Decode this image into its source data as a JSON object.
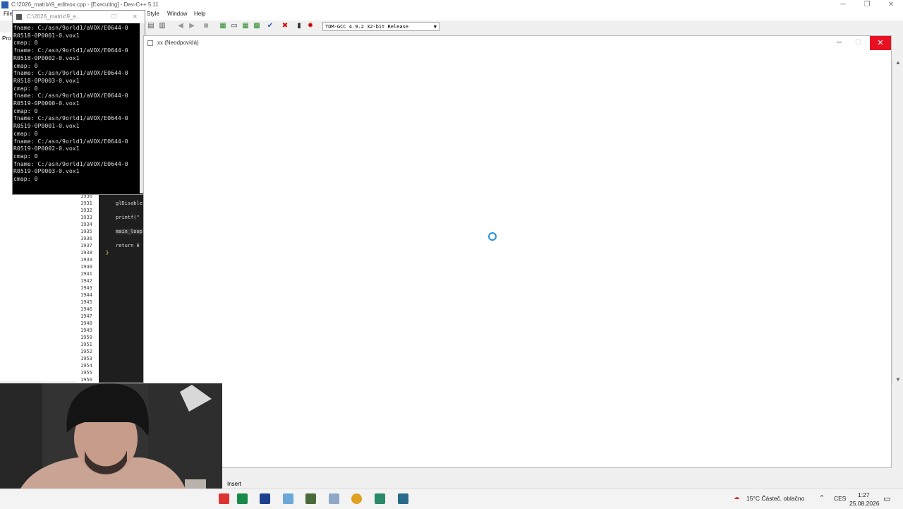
{
  "devcpp": {
    "title": "C:\\2026_matrix\\9_editvox.cpp - [Executing] - Dev-C++ 5.11",
    "menu": [
      "File",
      "Style",
      "Window",
      "Help"
    ],
    "project_tab": "Pro",
    "compiler": "TDM-GCC 4.9.2 32-bit Release",
    "line_numbers": [
      "1930",
      "1931",
      "1932",
      "1933",
      "1934",
      "1935",
      "1936",
      "1937",
      "1938",
      "1939",
      "1940",
      "1941",
      "1942",
      "1943",
      "1944",
      "1945",
      "1946",
      "1947",
      "1948",
      "1949",
      "1950",
      "1951",
      "1952",
      "1953",
      "1954",
      "1955",
      "1956"
    ],
    "code": {
      "l1931": "glDisable",
      "l1933": "printf(\"",
      "l1935": "main_loop",
      "l1937": "return 0",
      "l1938": "}"
    }
  },
  "console": {
    "title": "C:\\2026_matrix\\9_e...",
    "lines": [
      "fname: C:/asn/9orld1/aVOX/E0644-0",
      "R0518-0P0001-0.vox1",
      "cmap: 0",
      "fname: C:/asn/9orld1/aVOX/E0644-0",
      "R0518-0P0002-0.vox1",
      "cmap: 0",
      "fname: C:/asn/9orld1/aVOX/E0644-0",
      "R0518-0P0003-0.vox1",
      "cmap: 0",
      "fname: C:/asn/9orld1/aVOX/E0644-0",
      "R0519-0P0000-0.vox1",
      "cmap: 0",
      "fname: C:/asn/9orld1/aVOX/E0644-0",
      "R0519-0P0001-0.vox1",
      "cmap: 0",
      "fname: C:/asn/9orld1/aVOX/E0644-0",
      "R0519-0P0002-0.vox1",
      "cmap: 0",
      "fname: C:/asn/9orld1/aVOX/E0644-0",
      "R0519-0P0003-0.vox1",
      "cmap: 0"
    ]
  },
  "appwin": {
    "title": "xx (Neodpovídá)"
  },
  "statusbar": {
    "mode": "Insert"
  },
  "taskbar": {
    "weather": "15°C  Částeč. oblačno",
    "lang": "CES",
    "time": "1:27",
    "date": "25.08.2026"
  },
  "colors": {
    "close_red": "#e81123",
    "spinner_blue": "#1f8fde"
  }
}
